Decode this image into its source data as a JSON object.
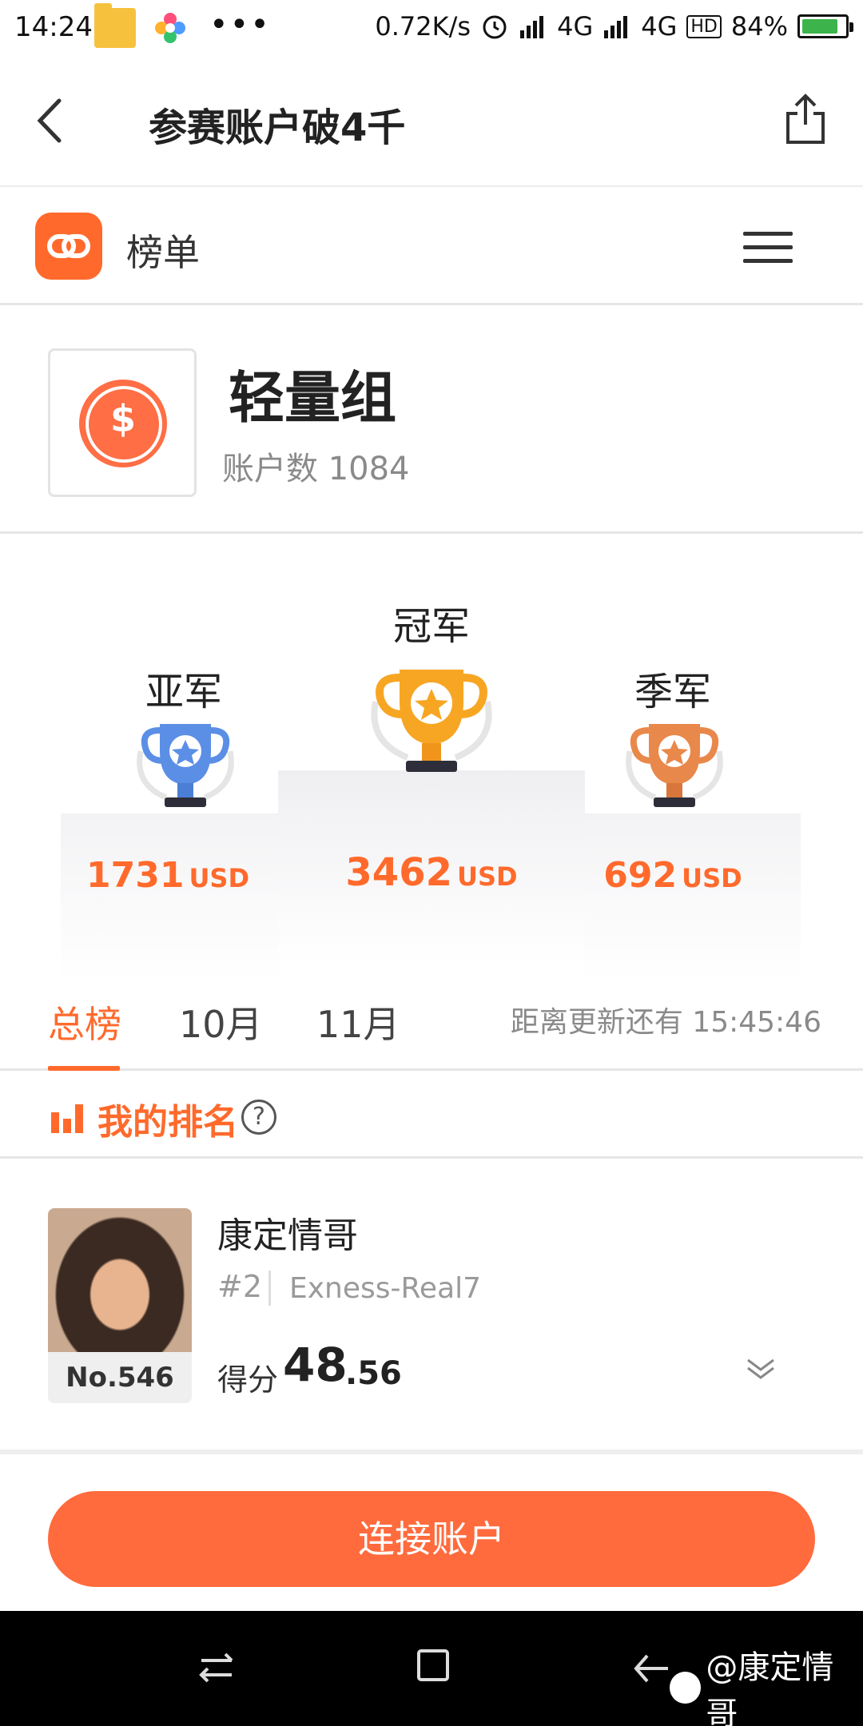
{
  "status_bar": {
    "time": "14:24",
    "speed": "0.72K/s",
    "net1": "4G",
    "net2": "4G",
    "battery": "84%"
  },
  "header": {
    "title": "参赛账户破4千",
    "back_icon": "back-arrow-icon",
    "share_icon": "share-icon"
  },
  "brand": {
    "name": "榜单",
    "logo_icon": "link-logo-icon",
    "menu_icon": "hamburger-menu-icon"
  },
  "group": {
    "name": "轻量组",
    "count_text": "账户数 1084",
    "icon": "dollar-coin-icon"
  },
  "podium": {
    "first": {
      "title": "冠军",
      "amount": "3462",
      "unit": "USD"
    },
    "second": {
      "title": "亚军",
      "amount": "1731",
      "unit": "USD"
    },
    "third": {
      "title": "季军",
      "amount": "692",
      "unit": "USD"
    }
  },
  "tabs": {
    "items": [
      {
        "label": "总榜",
        "active": true
      },
      {
        "label": "10月",
        "active": false
      },
      {
        "label": "11月",
        "active": false
      }
    ],
    "countdown": "距离更新还有 15:45:46"
  },
  "my_rank": {
    "label": "我的排名",
    "help": "?"
  },
  "user": {
    "name": "康定情哥",
    "position": "#2",
    "account": "Exness-Real7",
    "rank_badge": "No.546",
    "score_label": "得分",
    "score_int": "48",
    "score_dec": ".56"
  },
  "connect_button": "连接账户",
  "watermark": "@康定情哥",
  "colors": {
    "accent": "#ff6a2c",
    "gold": "#f7a623",
    "silver": "#5b8fe6",
    "bronze": "#e9884b"
  }
}
